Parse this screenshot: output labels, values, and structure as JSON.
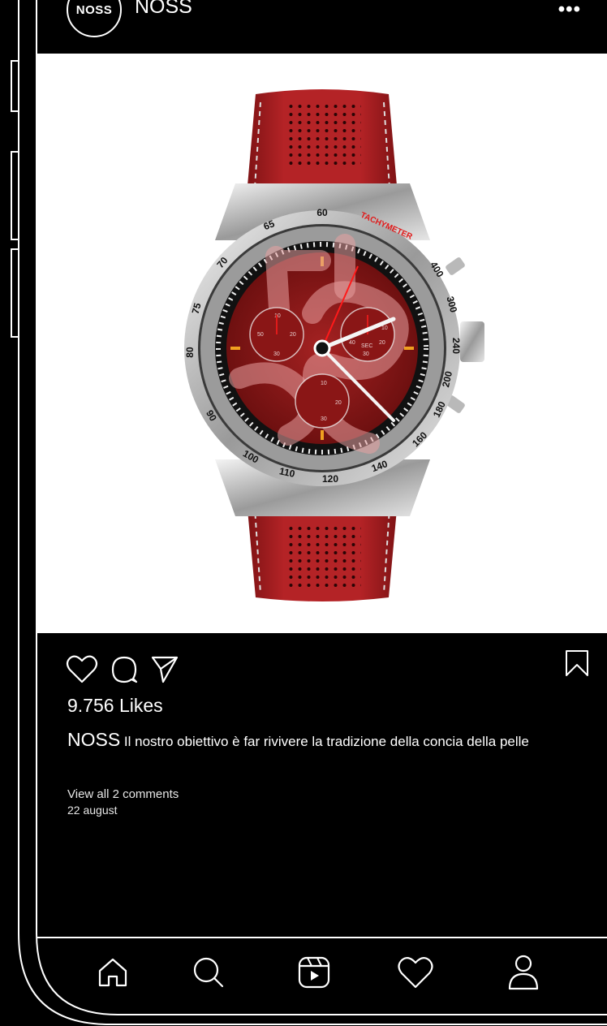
{
  "header": {
    "avatar_text": "NOSS",
    "username": "NOSS",
    "more_icon": "more-dots-icon"
  },
  "post": {
    "image_alt": "red leather strap chronograph watch",
    "watch_dial": {
      "bezel_numbers": [
        "60",
        "65",
        "70",
        "75",
        "80",
        "90",
        "100",
        "110",
        "120",
        "140",
        "160",
        "180",
        "200",
        "240",
        "300",
        "400"
      ],
      "bezel_label": "TACHYMETER",
      "subdial_left": [
        "10",
        "20",
        "30",
        "50"
      ],
      "subdial_right": [
        "10",
        "20",
        "30",
        "40",
        "SEC"
      ],
      "subdial_bottom": [
        "10",
        "20",
        "30"
      ]
    },
    "likes": "9.756 Likes",
    "caption_author": "NOSS",
    "caption_text": "Il nostro obiettivo è far rivivere la tradizione della concia della pelle",
    "comments_link": "View all 2 comments",
    "date": "22 august"
  },
  "actions": {
    "like_icon": "heart-icon",
    "comment_icon": "comment-icon",
    "share_icon": "send-icon",
    "save_icon": "bookmark-icon"
  },
  "tabbar": {
    "items": [
      "home-icon",
      "search-icon",
      "reels-icon",
      "heart-icon",
      "profile-icon"
    ]
  },
  "colors": {
    "background": "#000000",
    "text": "#ffffff",
    "strap": "#a81e20",
    "dial": "#8e1a1a",
    "accent_orange": "#f0a020",
    "tachymeter_red": "#e01a1a"
  }
}
